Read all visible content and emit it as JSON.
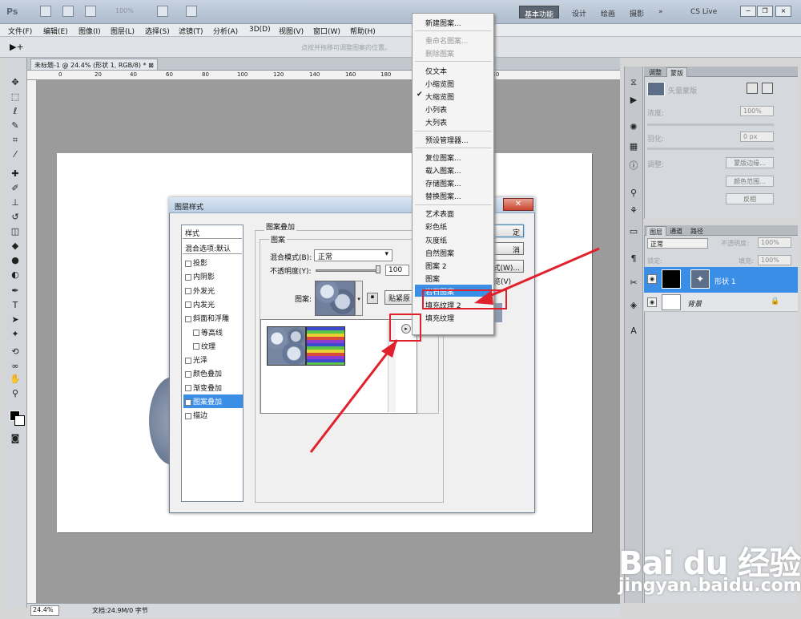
{
  "app": {
    "logo": "Ps",
    "zoom_dropdown": "100%",
    "workspaces": [
      "基本功能",
      "设计",
      "绘画",
      "摄影"
    ],
    "more": "»",
    "cs_live": "CS Live"
  },
  "menubar": [
    "文件(F)",
    "编辑(E)",
    "图像(I)",
    "图层(L)",
    "选择(S)",
    "滤镜(T)",
    "分析(A)",
    "3D(D)",
    "视图(V)",
    "窗口(W)",
    "帮助(H)"
  ],
  "options_bar": {
    "hint": "点按并拖移可调整图案的位置。"
  },
  "document": {
    "tab_title": "未标题-1 @ 24.4% (形状 1, RGB/8) *",
    "ruler_ticks": [
      "0",
      "20",
      "40",
      "60",
      "80",
      "100",
      "120",
      "140",
      "160",
      "180",
      "200",
      "220",
      "240"
    ]
  },
  "status": {
    "zoom": "24.4%",
    "doc_info": "文档:24.9M/0 字节"
  },
  "dialog": {
    "title": "图层样式",
    "styles_header": "样式",
    "blend_options": "混合选项:默认",
    "effects": [
      {
        "label": "投影",
        "checked": false,
        "indent": false,
        "active": false
      },
      {
        "label": "内阴影",
        "checked": false,
        "indent": false,
        "active": false
      },
      {
        "label": "外发光",
        "checked": false,
        "indent": false,
        "active": false
      },
      {
        "label": "内发光",
        "checked": false,
        "indent": false,
        "active": false
      },
      {
        "label": "斜面和浮雕",
        "checked": false,
        "indent": false,
        "active": false
      },
      {
        "label": "等高线",
        "checked": false,
        "indent": true,
        "active": false
      },
      {
        "label": "纹理",
        "checked": false,
        "indent": true,
        "active": false
      },
      {
        "label": "光泽",
        "checked": false,
        "indent": false,
        "active": false
      },
      {
        "label": "颜色叠加",
        "checked": false,
        "indent": false,
        "active": false
      },
      {
        "label": "渐变叠加",
        "checked": false,
        "indent": false,
        "active": false
      },
      {
        "label": "图案叠加",
        "checked": true,
        "indent": false,
        "active": true
      },
      {
        "label": "描边",
        "checked": false,
        "indent": false,
        "active": false
      }
    ],
    "group_title": "图案叠加",
    "sub_title": "图案",
    "blend_mode_label": "混合模式(B):",
    "blend_mode_value": "正常",
    "opacity_label": "不透明度(Y):",
    "opacity_value": "100",
    "pattern_label": "图案:",
    "snap_button": "贴紧原",
    "buttons": {
      "ok": "定",
      "cancel": "消",
      "new_style": "式(W)...",
      "preview": "览(V)"
    }
  },
  "pattern_menu": {
    "items": [
      {
        "label": "新建图案...",
        "disabled": false,
        "checked": false,
        "selected": false,
        "sep_after": true
      },
      {
        "label": "重命名图案...",
        "disabled": true,
        "checked": false,
        "selected": false,
        "sep_after": false
      },
      {
        "label": "删除图案",
        "disabled": true,
        "checked": false,
        "selected": false,
        "sep_after": true
      },
      {
        "label": "仅文本",
        "disabled": false,
        "checked": false,
        "selected": false,
        "sep_after": false
      },
      {
        "label": "小缩览图",
        "disabled": false,
        "checked": false,
        "selected": false,
        "sep_after": false
      },
      {
        "label": "大缩览图",
        "disabled": false,
        "checked": true,
        "selected": false,
        "sep_after": false
      },
      {
        "label": "小列表",
        "disabled": false,
        "checked": false,
        "selected": false,
        "sep_after": false
      },
      {
        "label": "大列表",
        "disabled": false,
        "checked": false,
        "selected": false,
        "sep_after": true
      },
      {
        "label": "预设管理器...",
        "disabled": false,
        "checked": false,
        "selected": false,
        "sep_after": true
      },
      {
        "label": "复位图案...",
        "disabled": false,
        "checked": false,
        "selected": false,
        "sep_after": false
      },
      {
        "label": "载入图案...",
        "disabled": false,
        "checked": false,
        "selected": false,
        "sep_after": false
      },
      {
        "label": "存储图案...",
        "disabled": false,
        "checked": false,
        "selected": false,
        "sep_after": false
      },
      {
        "label": "替换图案...",
        "disabled": false,
        "checked": false,
        "selected": false,
        "sep_after": true
      },
      {
        "label": "艺术表面",
        "disabled": false,
        "checked": false,
        "selected": false,
        "sep_after": false
      },
      {
        "label": "彩色纸",
        "disabled": false,
        "checked": false,
        "selected": false,
        "sep_after": false
      },
      {
        "label": "灰度纸",
        "disabled": false,
        "checked": false,
        "selected": false,
        "sep_after": false
      },
      {
        "label": "自然图案",
        "disabled": false,
        "checked": false,
        "selected": false,
        "sep_after": false
      },
      {
        "label": "图案 2",
        "disabled": false,
        "checked": false,
        "selected": false,
        "sep_after": false
      },
      {
        "label": "图案",
        "disabled": false,
        "checked": false,
        "selected": false,
        "sep_after": false
      },
      {
        "label": "岩石图案",
        "disabled": false,
        "checked": false,
        "selected": true,
        "sep_after": false
      },
      {
        "label": "填充纹理 2",
        "disabled": false,
        "checked": false,
        "selected": false,
        "sep_after": false
      },
      {
        "label": "填充纹理",
        "disabled": false,
        "checked": false,
        "selected": false,
        "sep_after": false
      }
    ]
  },
  "adjustments_panel": {
    "tabs": [
      "调整",
      "蒙版"
    ],
    "vector_mask": "矢量蒙版",
    "density_label": "浓度:",
    "density_value": "100%",
    "feather_label": "羽化:",
    "feather_value": "0 px",
    "refine_label": "调整:",
    "buttons": [
      "蒙版边缘...",
      "颜色范围...",
      "反相"
    ]
  },
  "layers_panel": {
    "tabs": [
      "图层",
      "通道",
      "路径"
    ],
    "blend_mode": "正常",
    "opacity_label": "不透明度:",
    "opacity_value": "100%",
    "lock_label": "锁定:",
    "fill_label": "填充:",
    "fill_value": "100%",
    "layers": [
      {
        "name": "形状 1",
        "selected": true
      },
      {
        "name": "背景",
        "selected": false
      }
    ]
  },
  "watermark": {
    "brand": "Bai du 经验",
    "url": "jingyan.baidu.com"
  },
  "colors": {
    "accent": "#3a8ee6",
    "highlight_red": "#e0202a"
  }
}
